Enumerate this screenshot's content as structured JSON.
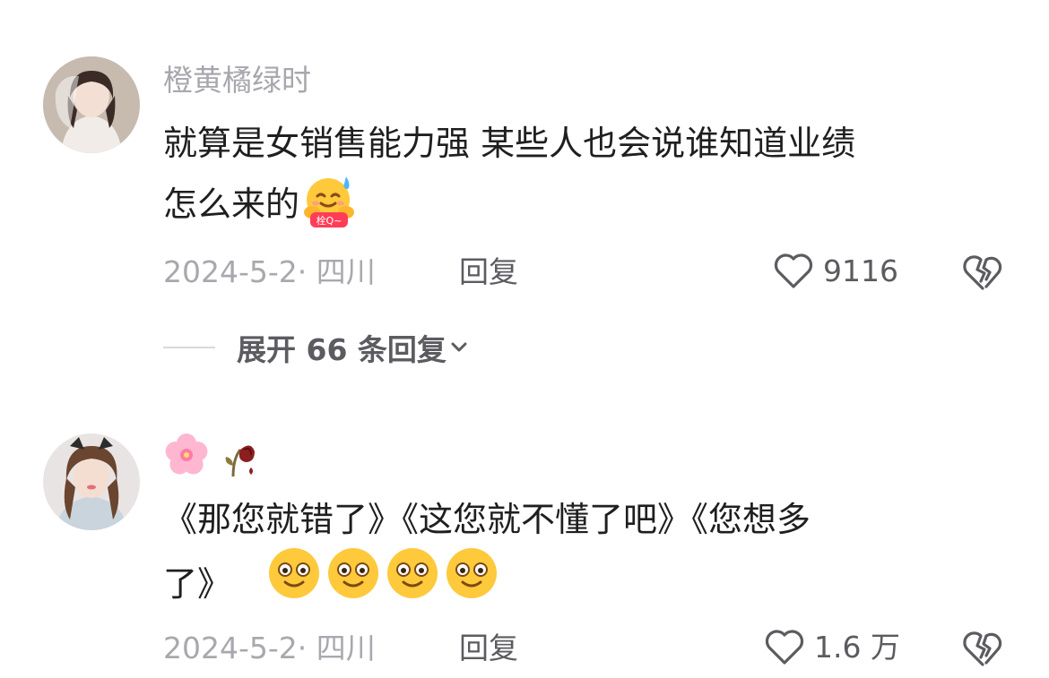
{
  "comments": [
    {
      "username": "橙黄橘绿时",
      "text_line1": "就算是女销售能力强  某些人也会说谁知道业绩",
      "text_line2": "怎么来的",
      "emoji_badge": "栓Q~",
      "meta": "2024-5-2· 四川",
      "reply_label": "回复",
      "likes": "9116",
      "expand_label": "展开 66 条回复",
      "icons": [
        "heart-icon",
        "broken-heart-icon",
        "chevron-down-icon",
        "sweat-hug-emoji"
      ]
    },
    {
      "username_emojis": [
        "cherry-blossom-emoji",
        "wilted-rose-emoji"
      ],
      "text_line1": "《那您就错了》《这您就不懂了吧》《您想多",
      "text_line2": "了》",
      "meta": "2024-5-2· 四川",
      "reply_label": "回复",
      "likes": "1.6 万",
      "icons": [
        "heart-icon",
        "broken-heart-icon",
        "smile-emoji"
      ]
    }
  ],
  "colors": {
    "text": "#1f1f1f",
    "muted": "#a8a8ae",
    "action": "#5b5b60"
  }
}
